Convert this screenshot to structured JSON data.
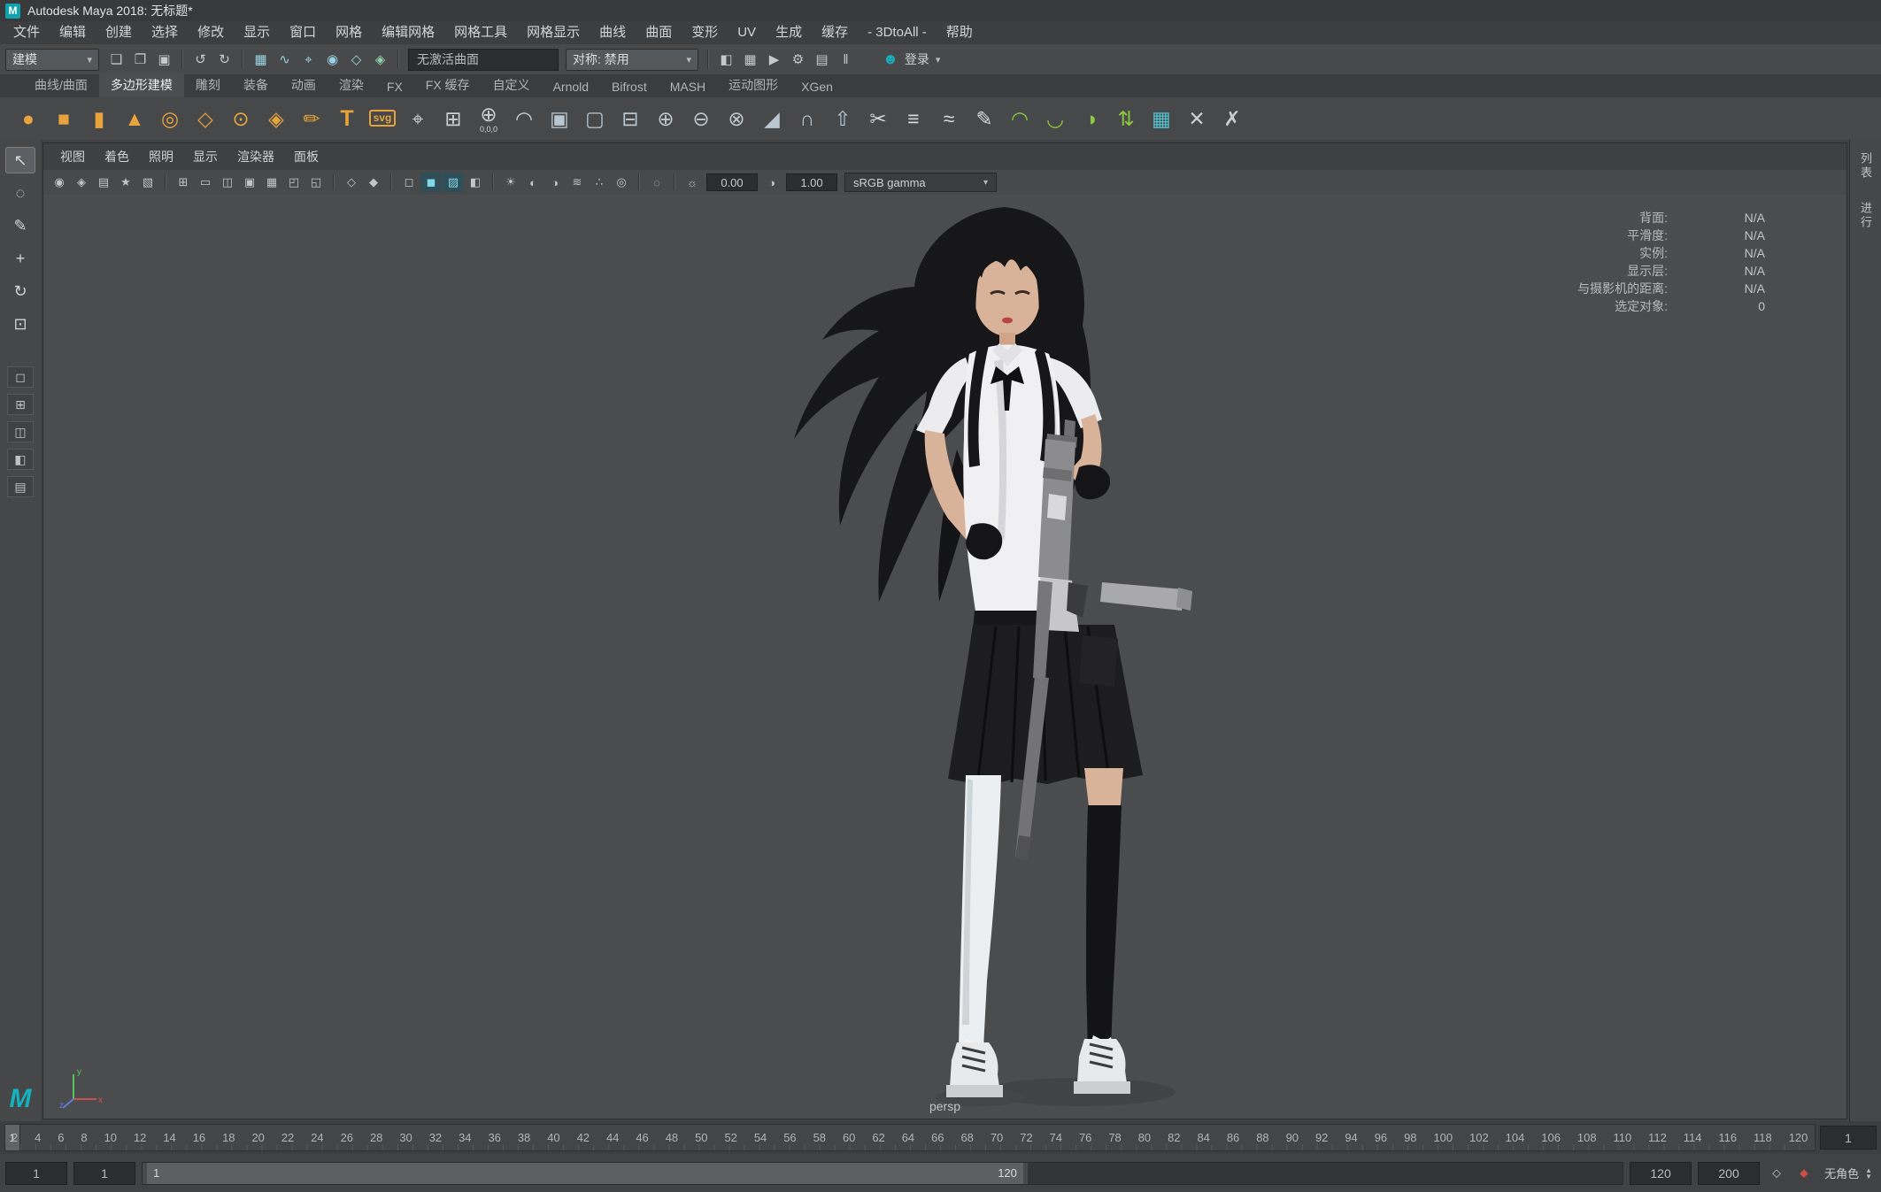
{
  "window": {
    "title": "Autodesk Maya 2018: 无标题*",
    "logo": "M"
  },
  "menu_bar": {
    "items": [
      {
        "label": "文件",
        "name": "menu-file"
      },
      {
        "label": "编辑",
        "name": "menu-edit"
      },
      {
        "label": "创建",
        "name": "menu-create"
      },
      {
        "label": "选择",
        "name": "menu-select"
      },
      {
        "label": "修改",
        "name": "menu-modify"
      },
      {
        "label": "显示",
        "name": "menu-display"
      },
      {
        "label": "窗口",
        "name": "menu-windows"
      },
      {
        "label": "网格",
        "name": "menu-mesh"
      },
      {
        "label": "编辑网格",
        "name": "menu-edit-mesh"
      },
      {
        "label": "网格工具",
        "name": "menu-mesh-tools"
      },
      {
        "label": "网格显示",
        "name": "menu-mesh-display"
      },
      {
        "label": "曲线",
        "name": "menu-curves"
      },
      {
        "label": "曲面",
        "name": "menu-surfaces"
      },
      {
        "label": "变形",
        "name": "menu-deform"
      },
      {
        "label": "UV",
        "name": "menu-uv"
      },
      {
        "label": "生成",
        "name": "menu-generate"
      },
      {
        "label": "缓存",
        "name": "menu-cache"
      },
      {
        "label": "- 3DtoAll -",
        "name": "menu-3dtoall"
      },
      {
        "label": "帮助",
        "name": "menu-help"
      }
    ]
  },
  "status_line": {
    "mode": "建模",
    "left_icons": [
      {
        "name": "new-scene-icon",
        "glyph": "❏"
      },
      {
        "name": "open-scene-icon",
        "glyph": "❐"
      },
      {
        "name": "save-scene-icon",
        "glyph": "▣"
      },
      {
        "cls": "sep",
        "name": "divider"
      },
      {
        "name": "undo-icon",
        "glyph": "↺"
      },
      {
        "name": "redo-icon",
        "glyph": "↻"
      },
      {
        "cls": "sep",
        "name": "divider"
      },
      {
        "name": "snap-to-grid-icon",
        "glyph": "▦",
        "color": "#9ad4e2"
      },
      {
        "name": "snap-to-curve-icon",
        "glyph": "∿",
        "color": "#9ad4e2"
      },
      {
        "name": "snap-to-point-icon",
        "glyph": "⌖",
        "color": "#9ad4e2"
      },
      {
        "name": "snap-to-projected-center-icon",
        "glyph": "◉",
        "color": "#9ad4e2"
      },
      {
        "name": "snap-to-view-plane-icon",
        "glyph": "◇",
        "color": "#9ad4e2"
      },
      {
        "name": "make-live-icon",
        "glyph": "◈",
        "color": "#8fd4a8"
      },
      {
        "cls": "sep",
        "name": "divider"
      }
    ],
    "no_active_surface": "无激活曲面",
    "symmetry": "对称: 禁用",
    "right_icons": [
      {
        "cls": "sep",
        "name": "divider"
      },
      {
        "name": "render-view-icon",
        "glyph": "◧"
      },
      {
        "name": "render-current-frame-icon",
        "glyph": "▦"
      },
      {
        "name": "ipr-render-icon",
        "glyph": "▶"
      },
      {
        "name": "render-settings-icon",
        "glyph": "⚙"
      },
      {
        "name": "render-setup-icon",
        "glyph": "▤"
      },
      {
        "name": "pause-viewport-icon",
        "glyph": "‖"
      }
    ],
    "login": "登录"
  },
  "shelf": {
    "tabs": [
      {
        "label": "曲线/曲面",
        "name": "shelf-tab-curves-surfaces"
      },
      {
        "label": "多边形建模",
        "name": "shelf-tab-poly-modeling",
        "cls": "active"
      },
      {
        "label": "雕刻",
        "name": "shelf-tab-sculpting"
      },
      {
        "label": "装备",
        "name": "shelf-tab-rigging"
      },
      {
        "label": "动画",
        "name": "shelf-tab-animation"
      },
      {
        "label": "渲染",
        "name": "shelf-tab-rendering"
      },
      {
        "label": "FX",
        "name": "shelf-tab-fx"
      },
      {
        "label": "FX 缓存",
        "name": "shelf-tab-fx-caching"
      },
      {
        "label": "自定义",
        "name": "shelf-tab-custom"
      },
      {
        "label": "Arnold",
        "name": "shelf-tab-arnold"
      },
      {
        "label": "Bifrost",
        "name": "shelf-tab-bifrost"
      },
      {
        "label": "MASH",
        "name": "shelf-tab-mash"
      },
      {
        "label": "运动图形",
        "name": "shelf-tab-motion-graphics"
      },
      {
        "label": "XGen",
        "name": "shelf-tab-xgen"
      }
    ],
    "items": [
      {
        "name": "poly-sphere-icon",
        "glyph": "●",
        "color": "#e8a33d"
      },
      {
        "name": "poly-cube-icon",
        "glyph": "■",
        "color": "#e8a33d"
      },
      {
        "name": "poly-cylinder-icon",
        "glyph": "▮",
        "color": "#e8a33d"
      },
      {
        "name": "poly-cone-icon",
        "glyph": "▲",
        "color": "#e8a33d"
      },
      {
        "name": "poly-torus-icon",
        "glyph": "◎",
        "color": "#e8a33d"
      },
      {
        "name": "poly-plane-icon",
        "glyph": "◇",
        "color": "#e8a33d"
      },
      {
        "name": "poly-disc-icon",
        "glyph": "⊙",
        "color": "#e8a33d"
      },
      {
        "name": "poly-platonic-icon",
        "glyph": "◈",
        "color": "#e8a33d"
      },
      {
        "name": "sculpt-tool-icon",
        "glyph": "✏",
        "color": "#e8a33d"
      },
      {
        "name": "create-type-icon",
        "glyph": "T",
        "color": "#e8a33d",
        "cls": "bold"
      },
      {
        "name": "svg-tool-icon",
        "glyph": "svg",
        "color": "#e8a33d",
        "cls": "badge"
      },
      {
        "name": "center-pivot-icon",
        "glyph": "⌖",
        "color": "#c9ced2"
      },
      {
        "name": "snap-together-icon",
        "glyph": "⊞",
        "color": "#c9ced2"
      },
      {
        "name": "move-to-origin-icon",
        "glyph": "⊕",
        "color": "#c9ced2",
        "sub": "0,0,0"
      },
      {
        "name": "smooth-mesh-icon",
        "glyph": "◠",
        "color": "#c9ced2"
      },
      {
        "name": "combine-icon",
        "glyph": "▣",
        "color": "#b9c7d0"
      },
      {
        "name": "separate-icon",
        "glyph": "▢",
        "color": "#b9c7d0"
      },
      {
        "name": "extract-icon",
        "glyph": "⊟",
        "color": "#b9c7d0"
      },
      {
        "name": "boolean-union-icon",
        "glyph": "⊕",
        "color": "#b9c7d0"
      },
      {
        "name": "boolean-difference-icon",
        "glyph": "⊖",
        "color": "#b9c7d0"
      },
      {
        "name": "boolean-intersection-icon",
        "glyph": "⊗",
        "color": "#b9c7d0"
      },
      {
        "name": "bevel-icon",
        "glyph": "◢",
        "color": "#b9c7d0"
      },
      {
        "name": "bridge-icon",
        "glyph": "∩",
        "color": "#b9c7d0"
      },
      {
        "name": "extrude-icon",
        "glyph": "⇧",
        "color": "#b9c7d0"
      },
      {
        "name": "multi-cut-icon",
        "glyph": "✂",
        "color": "#d8d8d8"
      },
      {
        "name": "connect-tool-icon",
        "glyph": "≡",
        "color": "#d8d8d8"
      },
      {
        "name": "crease-tool-icon",
        "glyph": "≈",
        "color": "#d8d8d8"
      },
      {
        "name": "quad-draw-icon",
        "glyph": "✎",
        "color": "#d8d8d8"
      },
      {
        "name": "soften-edge-icon",
        "glyph": "◠",
        "color": "#8dc63f"
      },
      {
        "name": "harden-edge-icon",
        "glyph": "◡",
        "color": "#8dc63f"
      },
      {
        "name": "toggle-soft-edge-icon",
        "glyph": "◑",
        "color": "#8dc63f"
      },
      {
        "name": "reverse-normals-icon",
        "glyph": "⇅",
        "color": "#8dc63f"
      },
      {
        "name": "uv-editor-icon",
        "glyph": "▦",
        "color": "#53c1cf"
      },
      {
        "name": "multi-component-icon",
        "glyph": "✕",
        "color": "#c9ced2"
      },
      {
        "name": "symmetry-x-icon",
        "glyph": "✗",
        "color": "#c9ced2"
      }
    ]
  },
  "toolbox": {
    "tools": [
      {
        "name": "select-tool",
        "glyph": "↖",
        "cls": "active"
      },
      {
        "name": "lasso-select-tool",
        "glyph": "◌"
      },
      {
        "name": "paint-select-tool",
        "glyph": "✎"
      },
      {
        "name": "move-tool",
        "glyph": "+"
      },
      {
        "name": "rotate-tool",
        "glyph": "↻"
      },
      {
        "name": "scale-tool",
        "glyph": "⊡"
      }
    ],
    "layouts": [
      {
        "name": "layout-single-pane-button",
        "glyph": "◻"
      },
      {
        "name": "layout-four-pane-button",
        "glyph": "⊞"
      },
      {
        "name": "layout-two-pane-button",
        "glyph": "◫"
      },
      {
        "name": "layout-outliner-persp-button",
        "glyph": "◧"
      },
      {
        "name": "layout-hypershade-persp-button",
        "glyph": "▤"
      }
    ]
  },
  "panel": {
    "menus": [
      {
        "label": "视图",
        "name": "panel-menu-view"
      },
      {
        "label": "着色",
        "name": "panel-menu-shading"
      },
      {
        "label": "照明",
        "name": "panel-menu-lighting"
      },
      {
        "label": "显示",
        "name": "panel-menu-show"
      },
      {
        "label": "渲染器",
        "name": "panel-menu-renderer"
      },
      {
        "label": "面板",
        "name": "panel-menu-panels"
      }
    ],
    "toolbar_icons": [
      {
        "name": "select-camera-icon",
        "glyph": "◉"
      },
      {
        "name": "lock-camera-icon",
        "glyph": "◈"
      },
      {
        "name": "camera-attributes-icon",
        "glyph": "▤"
      },
      {
        "name": "bookmark-icon",
        "glyph": "★"
      },
      {
        "name": "image-plane-icon",
        "glyph": "▧"
      },
      {
        "cls": "sep",
        "name": "divider"
      },
      {
        "name": "grid-icon",
        "glyph": "⊞"
      },
      {
        "name": "film-gate-icon",
        "glyph": "▭"
      },
      {
        "name": "resolution-gate-icon",
        "glyph": "◫"
      },
      {
        "name": "gate-mask-icon",
        "glyph": "▣"
      },
      {
        "name": "field-chart-icon",
        "glyph": "▦"
      },
      {
        "name": "safe-action-icon",
        "glyph": "◰"
      },
      {
        "name": "safe-title-icon",
        "glyph": "◱"
      },
      {
        "cls": "sep",
        "name": "divider"
      },
      {
        "name": "frame-all-icon",
        "glyph": "◇"
      },
      {
        "name": "frame-selected-icon",
        "glyph": "◆"
      },
      {
        "cls": "sep",
        "name": "divider"
      },
      {
        "name": "wireframe-icon",
        "glyph": "◻"
      },
      {
        "name": "smooth-shade-icon",
        "glyph": "◼",
        "cls": "active"
      },
      {
        "name": "textured-icon",
        "glyph": "▨",
        "cls": "active"
      },
      {
        "name": "use-default-material-icon",
        "glyph": "◧"
      },
      {
        "cls": "sep",
        "name": "divider"
      },
      {
        "name": "lights-icon",
        "glyph": "☀"
      },
      {
        "name": "shadows-icon",
        "glyph": "◐"
      },
      {
        "name": "ssao-icon",
        "glyph": "◑"
      },
      {
        "name": "motion-blur-icon",
        "glyph": "≋"
      },
      {
        "name": "anti-alias-icon",
        "glyph": "∴"
      },
      {
        "name": "depth-of-field-icon",
        "glyph": "◎"
      },
      {
        "cls": "sep",
        "name": "divider"
      },
      {
        "name": "isolate-select-icon",
        "glyph": "◌"
      },
      {
        "cls": "sep",
        "name": "divider"
      },
      {
        "name": "exposure-icon",
        "glyph": "☼"
      }
    ],
    "exposure": "0.00",
    "gamma": "1.00",
    "color_transform": "sRGB gamma"
  },
  "viewport": {
    "camera": "persp",
    "hud": [
      {
        "label": "背面:",
        "value": "N/A"
      },
      {
        "label": "平滑度:",
        "value": "N/A"
      },
      {
        "label": "实例:",
        "value": "N/A"
      },
      {
        "label": "显示层:",
        "value": "N/A"
      },
      {
        "label": "与摄影机的距离:",
        "value": "N/A"
      },
      {
        "label": "选定对象:",
        "value": "0"
      }
    ],
    "axis": {
      "x": "x",
      "y": "y",
      "z": "z"
    }
  },
  "right_sidebar": {
    "tabs": [
      {
        "label": "列表",
        "name": "right-tab-lists"
      },
      {
        "label": "进行",
        "name": "right-tab-progress"
      }
    ]
  },
  "timeline": {
    "frames": [
      2,
      4,
      6,
      8,
      10,
      12,
      14,
      16,
      18,
      20,
      22,
      24,
      26,
      28,
      30,
      32,
      34,
      36,
      38,
      40,
      42,
      44,
      46,
      48,
      50,
      52,
      54,
      56,
      58,
      60,
      62,
      64,
      66,
      68,
      70,
      72,
      74,
      76,
      78,
      80,
      82,
      84,
      86,
      88,
      90,
      92,
      94,
      96,
      98,
      100,
      102,
      104,
      106,
      108,
      110,
      112,
      114,
      116,
      118,
      120
    ],
    "current": "1"
  },
  "range_slider": {
    "anim_start": "1",
    "playback_start": "1",
    "bar_start": "1",
    "bar_end": "120",
    "playback_end": "120",
    "anim_end": "200",
    "character": "无角色"
  }
}
